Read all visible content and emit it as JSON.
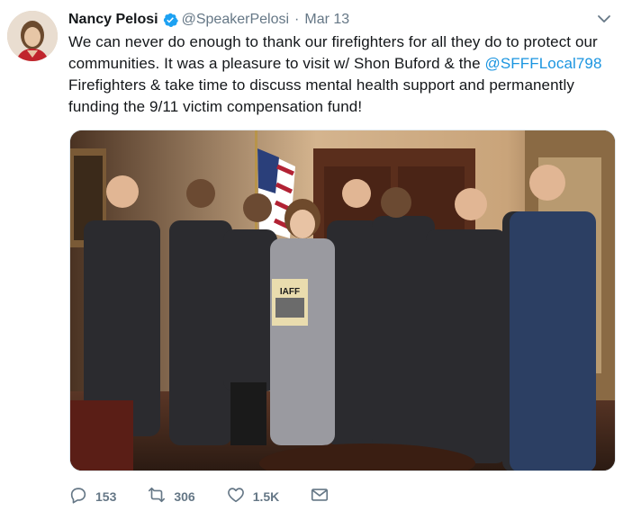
{
  "tweet": {
    "author_name": "Nancy Pelosi",
    "handle": "@SpeakerPelosi",
    "separator": "·",
    "date": "Mar 13",
    "text_part1": "We can never do enough to thank our firefighters for all they do to protect our communities. It was a pleasure to visit w/ Shon Buford & the ",
    "mention": "@SFFFLocal798",
    "text_part2": " Firefighters & take time to discuss mental health support and permanently funding the 9/11 victim compensation fund!",
    "photo_sign_text": "IAFF"
  },
  "actions": {
    "replies": "153",
    "retweets": "306",
    "likes": "1.5K"
  },
  "icons": {
    "verified": "verified-badge-icon",
    "caret": "chevron-down-icon",
    "reply": "reply-icon",
    "retweet": "retweet-icon",
    "like": "heart-icon",
    "share": "envelope-icon"
  },
  "colors": {
    "accent": "#1b95e0",
    "muted": "#657786",
    "text": "#14171a"
  }
}
